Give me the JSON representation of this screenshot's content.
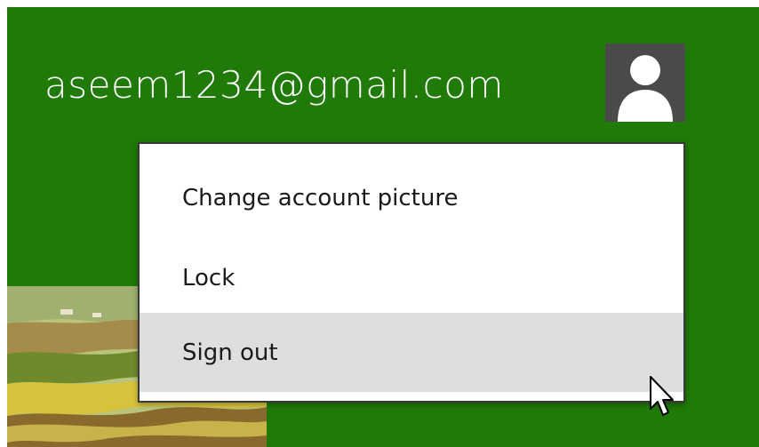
{
  "account": {
    "username": "aseem1234@gmail.com",
    "avatar_icon": "user-silhouette-icon"
  },
  "menu": {
    "items": [
      {
        "label": "Change account picture"
      },
      {
        "label": "Lock"
      },
      {
        "label": "Sign out",
        "highlighted": true
      }
    ]
  },
  "colors": {
    "background": "#1f7a07",
    "avatar_bg": "#4a4a4a",
    "menu_bg": "#ffffff",
    "hover_bg": "#dedede",
    "text": "#1a1a1a"
  },
  "cursor_icon": "mouse-pointer-icon"
}
